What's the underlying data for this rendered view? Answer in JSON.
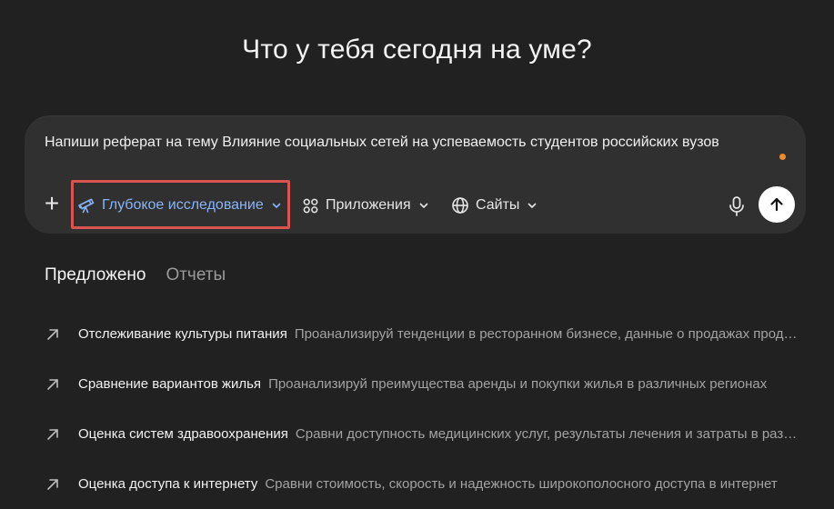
{
  "heading": "Что у тебя сегодня на уме?",
  "composer": {
    "prompt_text": "Напиши реферат на тему Влияние социальных сетей на успеваемость студентов российских вузов",
    "plus_icon": "plus-icon",
    "tools": [
      {
        "label": "Глубокое исследование",
        "icon": "telescope-icon",
        "accent": "#8ab4f8"
      },
      {
        "label": "Приложения",
        "icon": "apps-grid-icon"
      },
      {
        "label": "Сайты",
        "icon": "globe-icon"
      }
    ],
    "mic_icon": "microphone-icon",
    "send_icon": "arrow-up-icon",
    "highlight_color": "#d9534f",
    "typing_dot_color": "#f28a2a"
  },
  "tabs": [
    {
      "label": "Предложено",
      "active": true
    },
    {
      "label": "Отчеты",
      "active": false
    }
  ],
  "suggestions": [
    {
      "title": "Отслеживание культуры питания",
      "description": "Проанализируй тенденции в ресторанном бизнесе, данные о продажах продуктов питания и т. д."
    },
    {
      "title": "Сравнение вариантов жилья",
      "description": "Проанализируй преимущества аренды и покупки жилья в различных регионах"
    },
    {
      "title": "Оценка систем здравоохранения",
      "description": "Сравни доступность медицинских услуг, результаты лечения и затраты в разных странах"
    },
    {
      "title": "Оценка доступа к интернету",
      "description": "Сравни стоимость, скорость и надежность широкополосного доступа в интернет"
    }
  ]
}
